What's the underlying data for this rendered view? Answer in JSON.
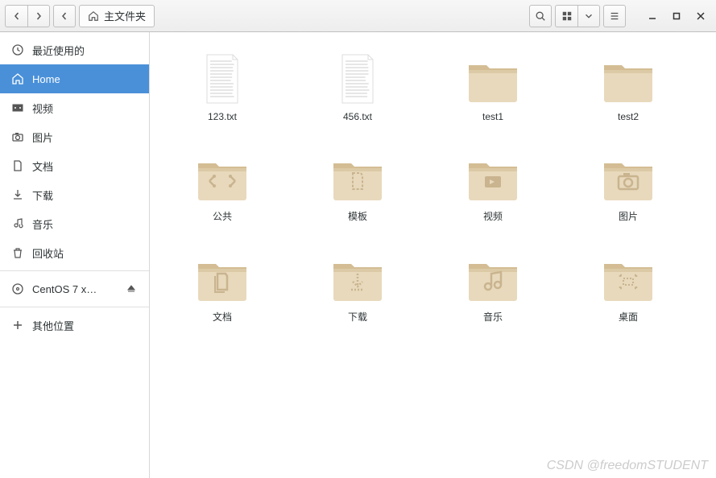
{
  "path": {
    "label": "主文件夹"
  },
  "sidebar": {
    "items": [
      {
        "label": "最近使用的",
        "icon": "clock",
        "active": false
      },
      {
        "label": "Home",
        "icon": "home",
        "active": true
      },
      {
        "label": "视频",
        "icon": "video",
        "active": false
      },
      {
        "label": "图片",
        "icon": "camera",
        "active": false
      },
      {
        "label": "文档",
        "icon": "document",
        "active": false
      },
      {
        "label": "下载",
        "icon": "download",
        "active": false
      },
      {
        "label": "音乐",
        "icon": "music",
        "active": false
      },
      {
        "label": "回收站",
        "icon": "trash",
        "active": false
      }
    ],
    "disk": {
      "label": "CentOS 7 x…",
      "icon": "disc"
    },
    "other": {
      "label": "其他位置",
      "icon": "plus"
    }
  },
  "files": [
    {
      "label": "123.txt",
      "type": "text"
    },
    {
      "label": "456.txt",
      "type": "text"
    },
    {
      "label": "test1",
      "type": "folder",
      "glyph": "none"
    },
    {
      "label": "test2",
      "type": "folder",
      "glyph": "none"
    },
    {
      "label": "公共",
      "type": "folder",
      "glyph": "share"
    },
    {
      "label": "模板",
      "type": "folder",
      "glyph": "template"
    },
    {
      "label": "视频",
      "type": "folder",
      "glyph": "video"
    },
    {
      "label": "图片",
      "type": "folder",
      "glyph": "camera"
    },
    {
      "label": "文档",
      "type": "folder",
      "glyph": "document"
    },
    {
      "label": "下载",
      "type": "folder",
      "glyph": "download"
    },
    {
      "label": "音乐",
      "type": "folder",
      "glyph": "music"
    },
    {
      "label": "桌面",
      "type": "folder",
      "glyph": "desktop"
    }
  ],
  "watermark": "CSDN @freedomSTUDENT"
}
